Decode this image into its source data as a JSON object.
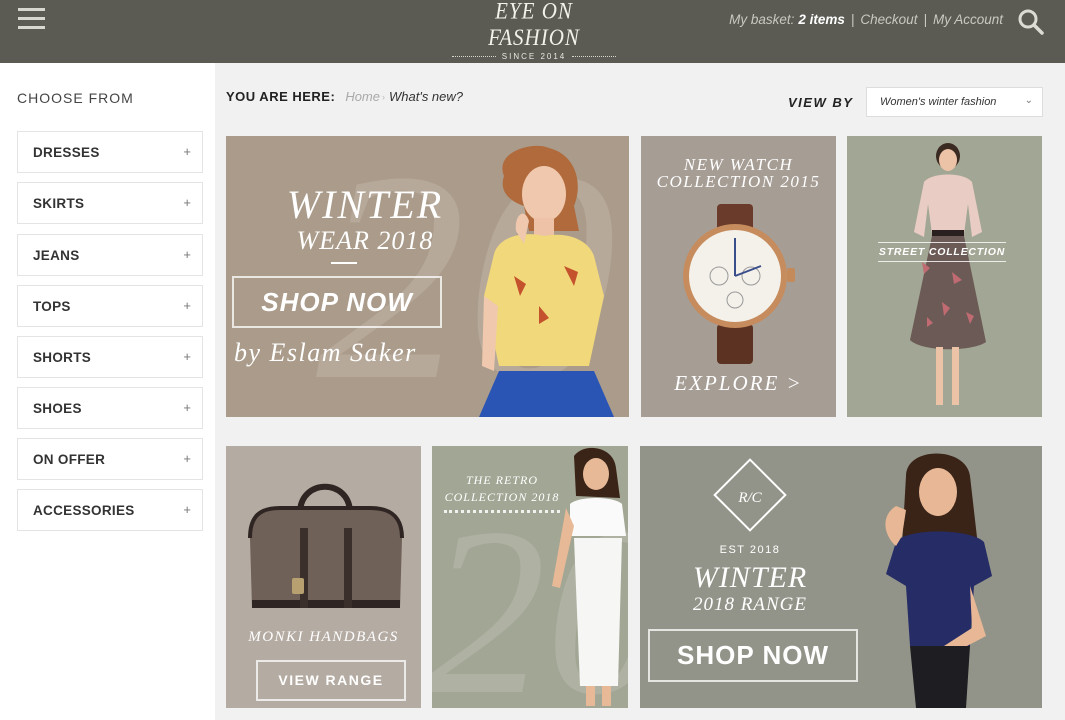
{
  "header": {
    "logo_name": "EYE ON FASHION",
    "logo_since": "SINCE 2014",
    "basket_label": "My basket:",
    "basket_count": "2 items",
    "checkout": "Checkout",
    "my_account": "My Account",
    "sep": "|"
  },
  "sidebar": {
    "title": "CHOOSE FROM",
    "plus": "+",
    "items": [
      {
        "label": "DRESSES"
      },
      {
        "label": "SKIRTS"
      },
      {
        "label": "JEANS"
      },
      {
        "label": "TOPS"
      },
      {
        "label": "SHORTS"
      },
      {
        "label": "SHOES"
      },
      {
        "label": "ON OFFER"
      },
      {
        "label": "ACCESSORIES"
      }
    ]
  },
  "breadcrumb": {
    "label": "YOU ARE HERE:",
    "home": "Home",
    "arrow": "›",
    "current": "What's new?"
  },
  "view_by": {
    "label": "VIEW BY",
    "selected": "Women's winter fashion",
    "chevron": "⌄"
  },
  "tiles": {
    "winter_wear": {
      "big_number": "20",
      "title_line1": "WINTER",
      "title_line2": "WEAR 2018",
      "button": "SHOP NOW",
      "byline": "by Eslam Saker"
    },
    "watch": {
      "title_line1": "NEW WATCH",
      "title_line2": "COLLECTION 2015",
      "explore": "EXPLORE >"
    },
    "street": {
      "label": "STREET COLLECTION"
    },
    "handbags": {
      "name": "MONKI HANDBAGS",
      "button": "VIEW RANGE"
    },
    "retro": {
      "big_number": "20",
      "title_line1": "THE RETRO",
      "title_line2": "COLLECTION 2018"
    },
    "winter_range": {
      "badge_letters": "R/C",
      "est": "EST 2018",
      "title_line1": "WINTER",
      "title_line2": "2018 RANGE",
      "button": "SHOP NOW"
    }
  },
  "colors": {
    "header_bg": "#5b5b54",
    "tile_taupe": "#aa9b8a",
    "tile_sage": "#a2a694",
    "tile_grey": "#939489"
  }
}
